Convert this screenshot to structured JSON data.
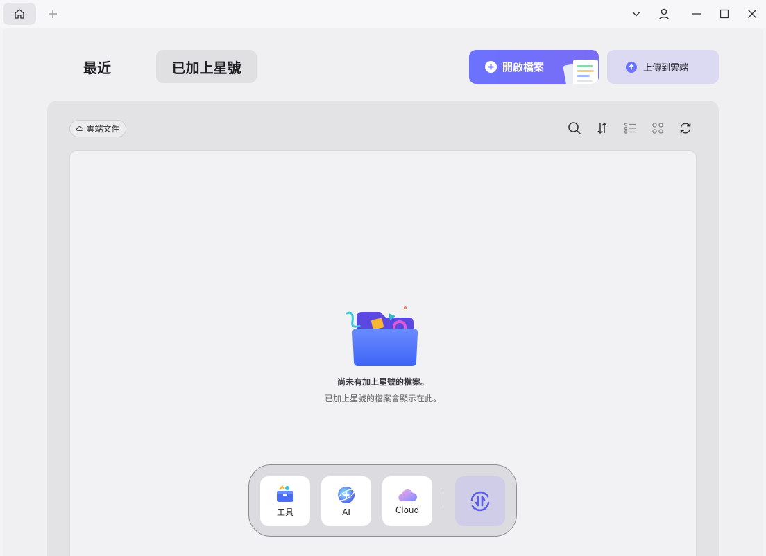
{
  "nav": {
    "recent_label": "最近",
    "starred_label": "已加上星號"
  },
  "actions": {
    "open_label": "開啟檔案",
    "upload_label": "上傳到雲端"
  },
  "files": {
    "cloud_chip_label": "雲端文件",
    "toolbar_icons": [
      "search-icon",
      "sort-icon",
      "list-view-icon",
      "grid-view-icon",
      "refresh-icon"
    ]
  },
  "empty_state": {
    "title": "尚未有加上星號的檔案。",
    "subtitle": "已加上星號的檔案會顯示在此。"
  },
  "dock": {
    "tools_label": "工具",
    "ai_label": "AI",
    "cloud_label": "Cloud"
  },
  "colors": {
    "accent": "#6b72ff",
    "upload_bg": "#dcdaf2",
    "sync_bg": "#cfcde8"
  }
}
